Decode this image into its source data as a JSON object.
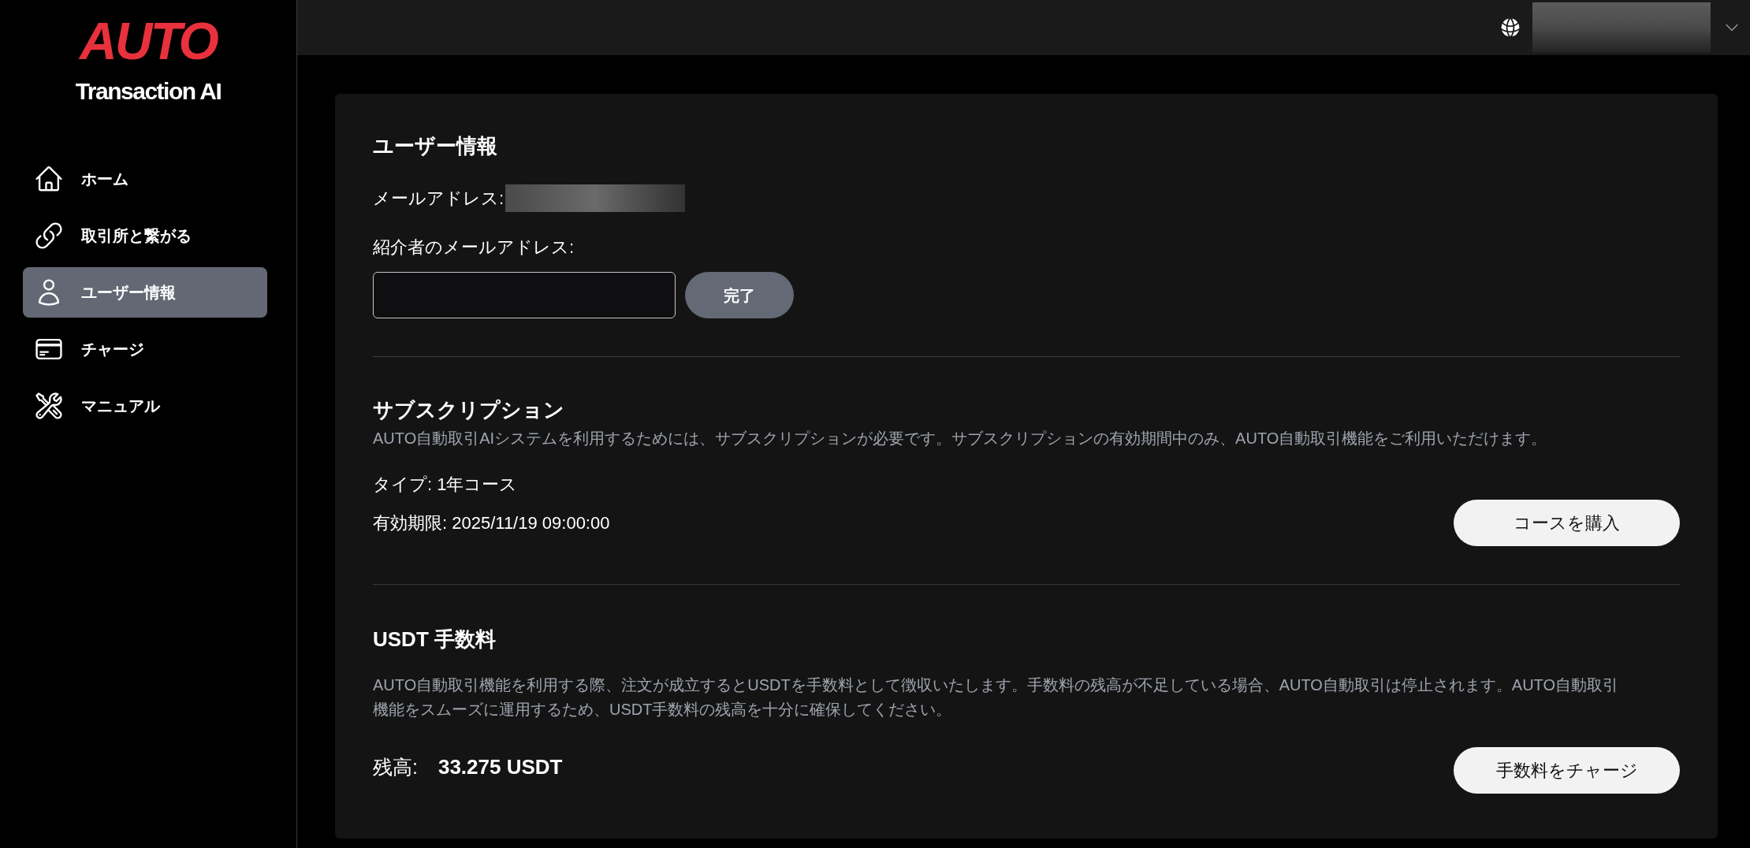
{
  "sidebar": {
    "logo": {
      "brand": "AUTO",
      "product": "Transaction AI"
    },
    "items": [
      {
        "label": "ホーム",
        "selected": false
      },
      {
        "label": "取引所と繋がる",
        "selected": false
      },
      {
        "label": "ユーザー情報",
        "selected": true
      },
      {
        "label": "チャージ",
        "selected": false
      },
      {
        "label": "マニュアル",
        "selected": false
      }
    ]
  },
  "user_info": {
    "title": "ユーザー情報",
    "email_label": "メールアドレス:",
    "referrer_label": "紹介者のメールアドレス:",
    "submit_button": "完了"
  },
  "subscription": {
    "title": "サブスクリプション",
    "description": "AUTO自動取引AIシステムを利用するためには、サブスクリプションが必要です。サブスクリプションの有効期間中のみ、AUTO自動取引機能をご利用いただけます。",
    "type": "タイプ: 1年コース",
    "expiry": "有効期限: 2025/11/19 09:00:00",
    "button": "コースを購入"
  },
  "usdt_fee": {
    "title": "USDT 手数料",
    "description": "AUTO自動取引機能を利用する際、注文が成立するとUSDTを手数料として徴収いたします。手数料の残高が不足している場合、AUTO自動取引は停止されます。AUTO自動取引機能をスムーズに運用するため、USDT手数料の残高を十分に確保してください。",
    "balance_label": "残高:",
    "balance_value": "33.275 USDT",
    "button": "手数料をチャージ"
  }
}
